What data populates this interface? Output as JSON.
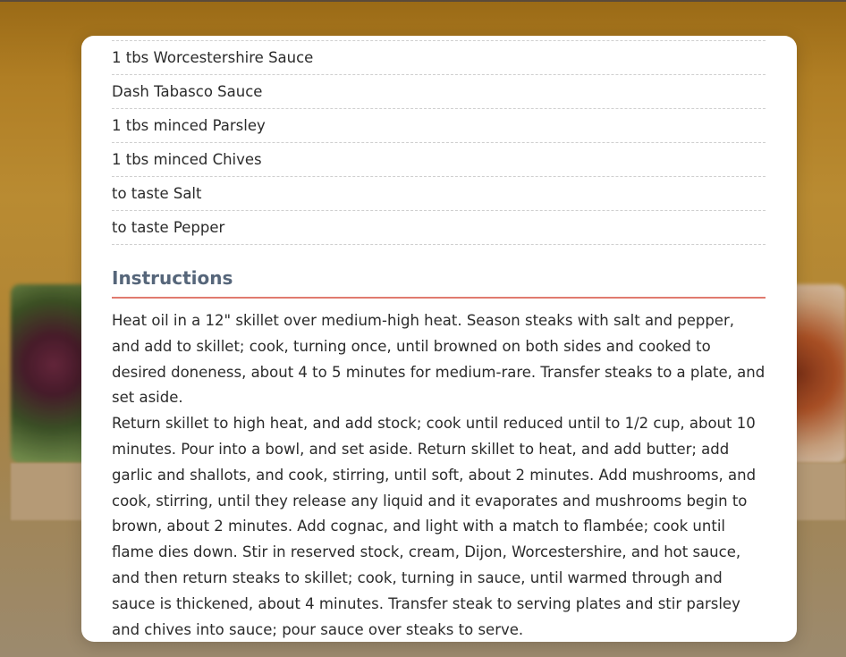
{
  "ingredients": [
    "1 tbs Worcestershire Sauce",
    "Dash Tabasco Sauce",
    "1 tbs minced Parsley",
    "1 tbs minced Chives",
    "to taste Salt",
    "to taste Pepper"
  ],
  "instructions_heading": "Instructions",
  "instructions": [
    "Heat oil in a 12\" skillet over medium-high heat. Season steaks with salt and pepper, and add to skillet; cook, turning once, until browned on both sides and cooked to desired doneness, about 4 to 5 minutes for medium-rare. Transfer steaks to a plate, and set aside.",
    "Return skillet to high heat, and add stock; cook until reduced until to 1/2 cup, about 10 minutes. Pour into a bowl, and set aside. Return skillet to heat, and add butter; add garlic and shallots, and cook, stirring, until soft, about 2 minutes. Add mushrooms, and cook, stirring, until they release any liquid and it evaporates and mushrooms begin to brown, about 2 minutes. Add cognac, and light with a match to flambée; cook until flame dies down. Stir in reserved stock, cream, Dijon, Worcestershire, and hot sauce, and then return steaks to skillet; cook, turning in sauce, until warmed through and sauce is thickened, about 4 minutes. Transfer steak to serving plates and stir parsley and chives into sauce; pour sauce over steaks to serve."
  ],
  "colors": {
    "heading": "#56667a",
    "heading_rule": "#e07a6f",
    "text": "#2b2b2b",
    "background": "#b38734"
  }
}
